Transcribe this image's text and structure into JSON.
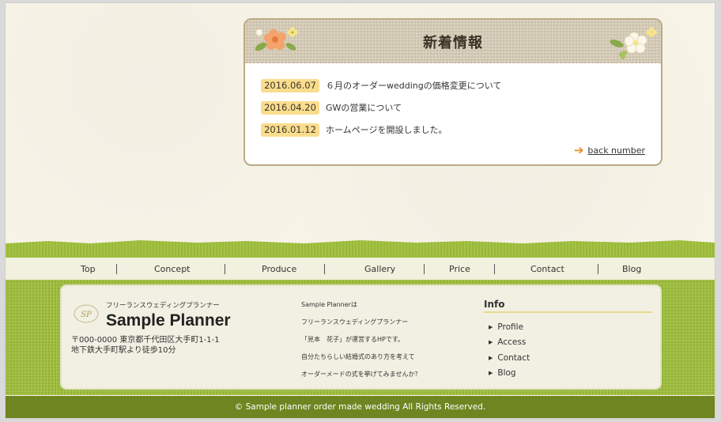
{
  "news": {
    "title": "新着情報",
    "items": [
      {
        "date": "2016.06.07",
        "text": "６月のオーダーweddingの価格変更について"
      },
      {
        "date": "2016.04.20",
        "text": "GWの営業について"
      },
      {
        "date": "2016.01.12",
        "text": "ホームページを開設しました。"
      }
    ],
    "back_number": "back number"
  },
  "nav": {
    "items": [
      "Top",
      "Concept",
      "Produce",
      "Gallery",
      "Price",
      "Contact",
      "Blog"
    ]
  },
  "footer": {
    "logo_text": "SP",
    "tagline": "フリーランスウェディングプランナー",
    "brand": "Sample Planner",
    "address_line1": "〒000-0000 東京都千代田区大手町1-1-1",
    "address_line2": "地下鉄大手町駅より徒歩10分",
    "about": [
      "Sample Plannerは",
      "フリーランスウェディングプランナー",
      "「見本　花子」が運営するHPです。",
      "自分たちらしい結婚式のあり方を考えて",
      "オーダーメードの式を挙げてみませんか？"
    ],
    "info_title": "Info",
    "info_items": [
      "Profile",
      "Access",
      "Contact",
      "Blog"
    ],
    "copyright": "© Sample planner order made wedding All Rights Reserved."
  },
  "colors": {
    "green": "#9fbf3b",
    "dark_green": "#6e8521",
    "date_badge": "#f9dd8e",
    "arrow": "#e98a1f"
  }
}
